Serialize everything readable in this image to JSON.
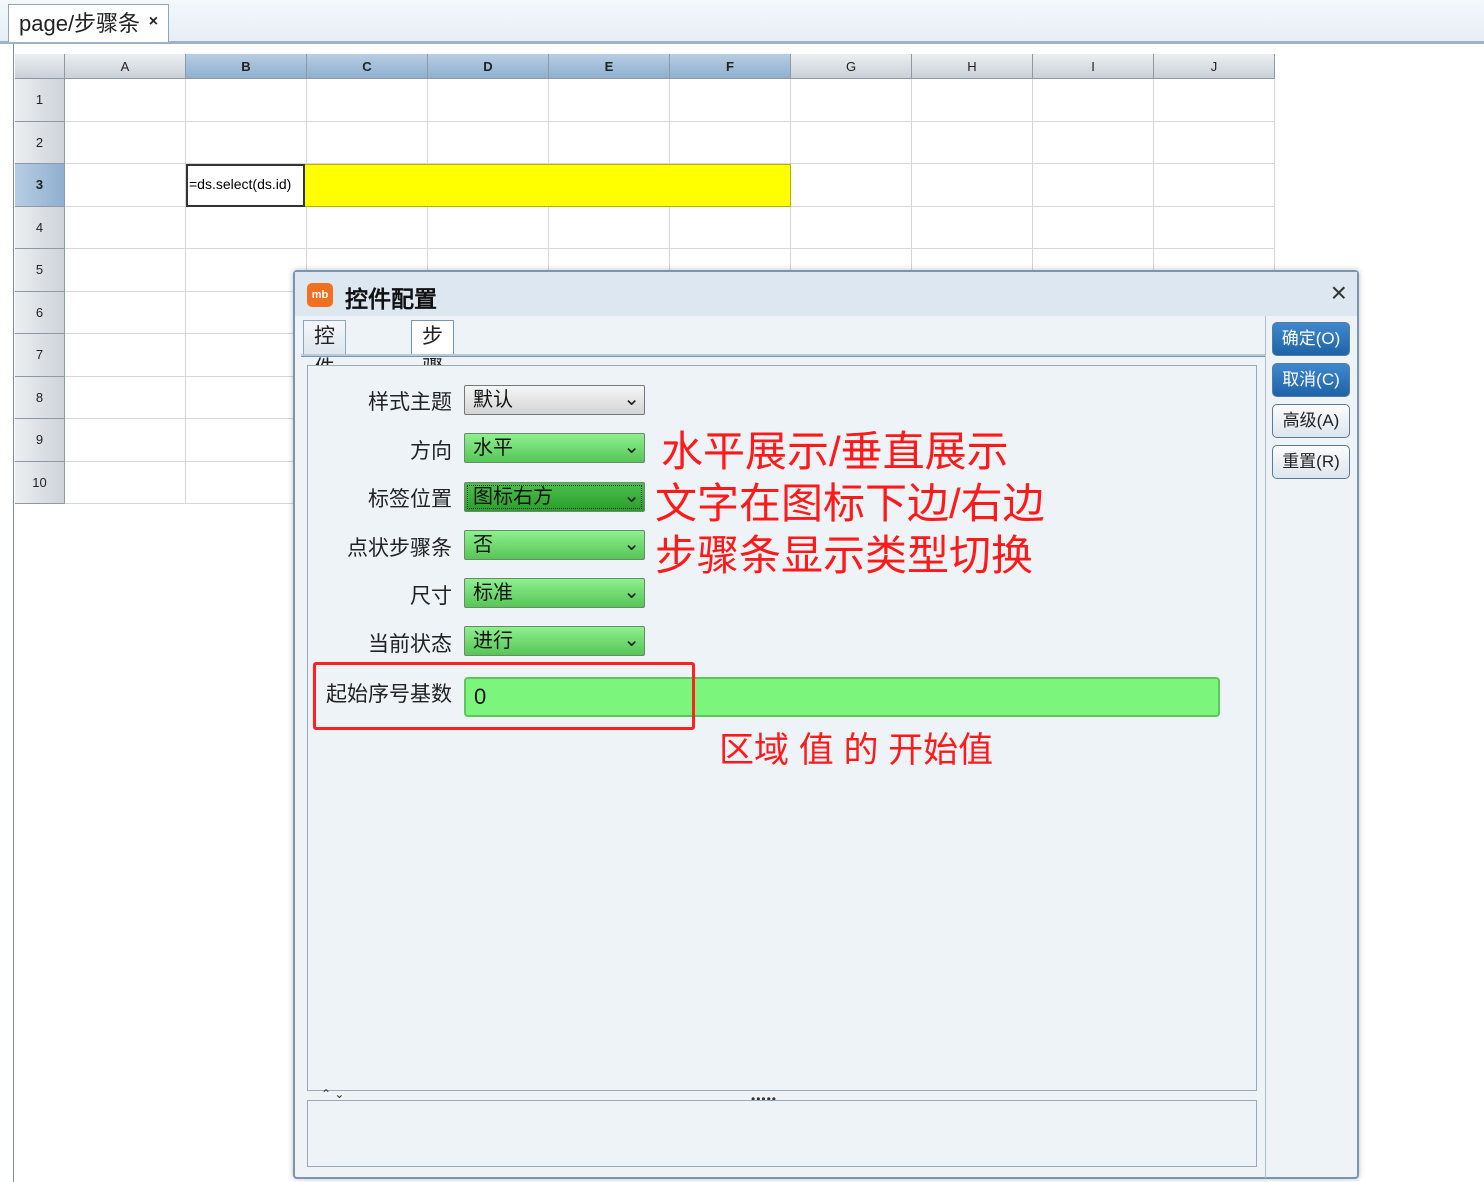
{
  "editor_tab": {
    "title": "page/步骤条",
    "close": "×"
  },
  "sheet": {
    "columns": [
      "A",
      "B",
      "C",
      "D",
      "E",
      "F",
      "G",
      "H",
      "I",
      "J"
    ],
    "rows": [
      "1",
      "2",
      "3",
      "4",
      "5",
      "6",
      "7",
      "8",
      "9",
      "10"
    ],
    "selected_row": "3",
    "formula_cell": "=ds.select(ds.id)"
  },
  "dialog": {
    "title": "控件配置",
    "logo": "mb",
    "close": "×",
    "tabs": [
      "控件类型",
      "步骤条"
    ],
    "active_tab": "步骤条",
    "fields": [
      {
        "label": "样式主题",
        "value": "默认"
      },
      {
        "label": "方向",
        "value": "水平"
      },
      {
        "label": "标签位置",
        "value": "图标右方"
      },
      {
        "label": "点状步骤条",
        "value": "否"
      },
      {
        "label": "尺寸",
        "value": "标准"
      },
      {
        "label": "当前状态",
        "value": "进行"
      }
    ],
    "start_index": {
      "label": "起始序号基数",
      "value": "0"
    },
    "buttons": {
      "ok": "确定(O)",
      "cancel": "取消(C)",
      "advanced": "高级(A)",
      "reset": "重置(R)"
    },
    "splitter": {
      "dots": "•••••",
      "arrows": "⌃ ⌄"
    }
  },
  "annotations": {
    "direction": "水平展示/垂直展示",
    "label_position": "文字在图标下边/右边",
    "dot_steps": "步骤条显示类型切换",
    "start_index": "区域 值 的 开始值"
  },
  "colors": {
    "annotation": "#ff1a1a",
    "selected_cells": "#ffff00",
    "combo_green": "#56c656",
    "primary_button": "#1e63a8"
  }
}
